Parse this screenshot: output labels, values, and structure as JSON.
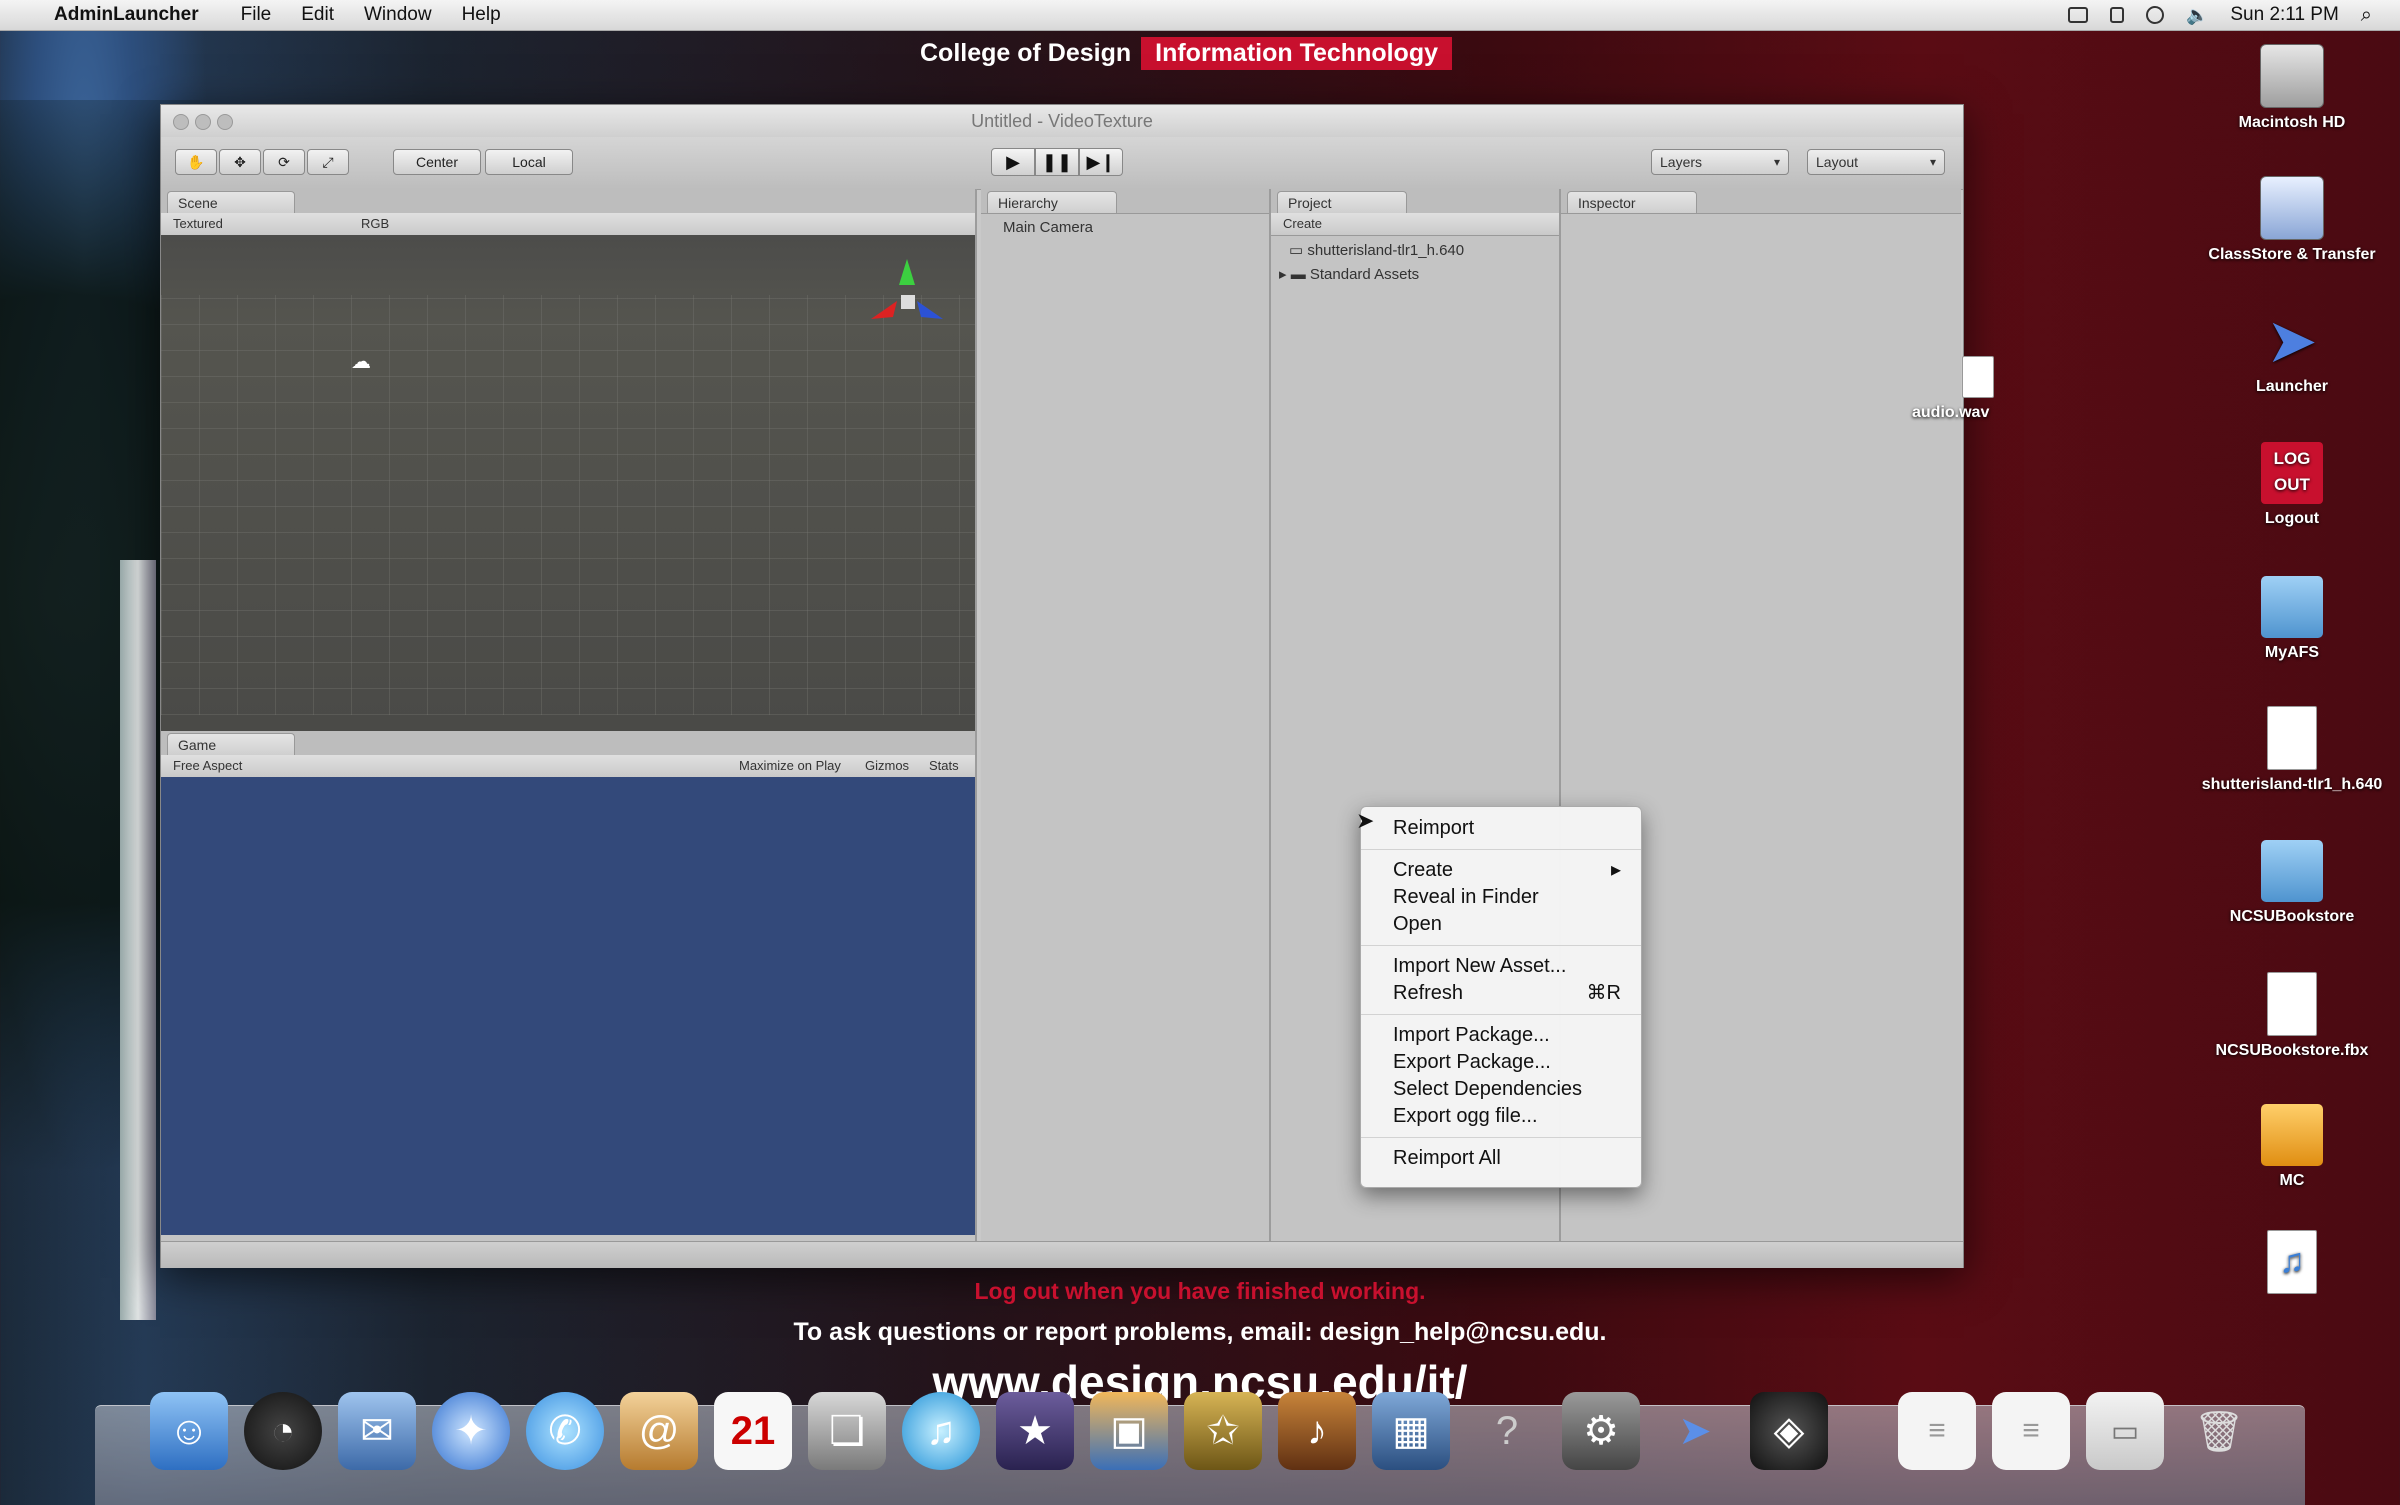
{
  "menubar": {
    "app_name": "AdminLauncher",
    "items": [
      "File",
      "Edit",
      "Window",
      "Help"
    ],
    "clock": "Sun 2:11 PM"
  },
  "banner": {
    "part1": "College of Design",
    "part2": "Information Technology"
  },
  "footer": {
    "warning": "Log out when you have finished working.",
    "help": "To ask questions or report problems, email: design_help@ncsu.edu.",
    "url": "www.design.ncsu.edu/it/"
  },
  "window": {
    "title": "Untitled - VideoTexture",
    "toolbar": {
      "pivot": "Center",
      "space": "Local",
      "layers": "Layers",
      "layout": "Layout"
    },
    "scene": {
      "tab": "Scene",
      "draw_mode": "Textured",
      "render_mode": "RGB"
    },
    "game": {
      "tab": "Game",
      "aspect": "Free Aspect",
      "maximize": "Maximize on Play",
      "gizmos": "Gizmos",
      "stats": "Stats"
    },
    "hierarchy": {
      "tab": "Hierarchy",
      "items": [
        "Main Camera"
      ]
    },
    "project": {
      "tab": "Project",
      "create": "Create",
      "items": [
        "shutterisland-tlr1_h.640",
        "Standard Assets"
      ]
    },
    "inspector": {
      "tab": "Inspector"
    }
  },
  "context_menu": {
    "reimport": "Reimport",
    "create": "Create",
    "reveal": "Reveal in Finder",
    "open": "Open",
    "import_new": "Import New Asset...",
    "refresh": "Refresh",
    "refresh_shortcut": "⌘R",
    "import_pkg": "Import Package...",
    "export_pkg": "Export Package...",
    "select_deps": "Select Dependencies",
    "export_ogg": "Export ogg file...",
    "reimport_all": "Reimport All"
  },
  "desktop_icons": [
    {
      "label": "Macintosh HD",
      "icon": "hard-drive-icon"
    },
    {
      "label": "ClassStore & Transfer",
      "icon": "network-drive-icon"
    },
    {
      "label": "Launcher",
      "icon": "launcher-icon"
    },
    {
      "label": "Logout",
      "icon": "logout-icon"
    },
    {
      "label": "MyAFS",
      "icon": "folder-icon"
    },
    {
      "label": "shutterisland-tlr1_h.640",
      "icon": "video-file-icon"
    },
    {
      "label": "NCSUBookstore",
      "icon": "folder-icon"
    },
    {
      "label": "NCSUBookstore.fbx",
      "icon": "document-icon"
    },
    {
      "label": "MC",
      "icon": "external-drive-icon"
    }
  ],
  "desktop_stray": {
    "label": "audio.wav"
  },
  "logout_glyph": "LOG OUT",
  "colors": {
    "accent": "#c8102e",
    "game_bg": "#33497a"
  }
}
